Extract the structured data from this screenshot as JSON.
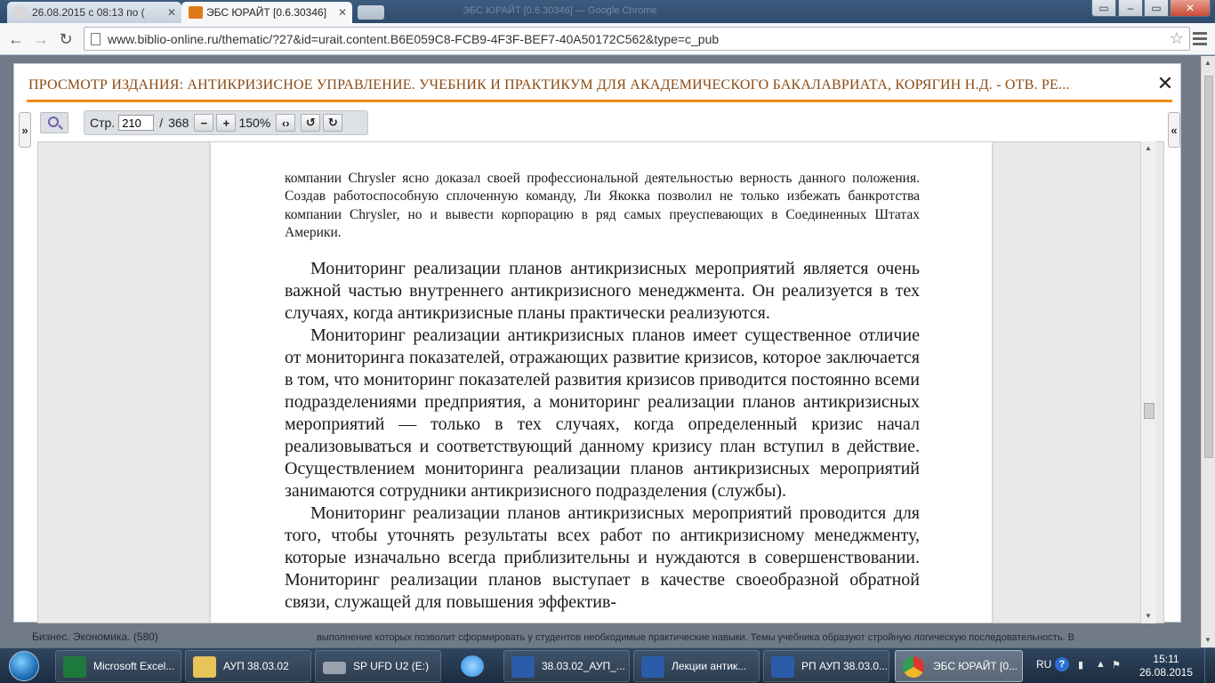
{
  "browser": {
    "tabs": [
      {
        "title": "26.08.2015 с 08:13 по (",
        "active": false,
        "favicon_color": "#d8d8d8"
      },
      {
        "title": "ЭБС ЮРАЙТ [0.6.30346]",
        "active": true,
        "favicon_color": "#e07a17"
      }
    ],
    "faint_title": "ЭБС ЮРАЙТ [0.6.30346] — Google Chrome",
    "address": "www.biblio-online.ru/thematic/?27&id=urait.content.B6E059C8-FCB9-4F3F-BEF7-40A50172C562&type=c_pub",
    "window_controls": {
      "minimize": "–",
      "maximize": "▭",
      "close": "✕"
    }
  },
  "viewer": {
    "title": "ПРОСМОТР ИЗДАНИЯ: АНТИКРИЗИСНОЕ УПРАВЛЕНИЕ. УЧЕБНИК И ПРАКТИКУМ ДЛЯ АКАДЕМИЧЕСКОГО БАКАЛАВРИАТА, КОРЯГИН Н.Д. - ОТВ. РЕ...",
    "close_label": "✕",
    "left_toggle": "»",
    "right_toggle": "«",
    "page_label": "Стр.",
    "page_current": "210",
    "page_separator": "/",
    "page_total": "368",
    "zoom_out": "−",
    "zoom_in": "+",
    "zoom_level": "150%",
    "fit_width": "‹›",
    "rotate_left": "↺",
    "rotate_right": "↻"
  },
  "document": {
    "quote_lines": [
      "компании Chrysler ясно доказал своей профессиональной деятельностью верность данного положения. Создав работоспособную сплоченную команду, Ли Якокка позволил не только избежать банкротства компании Chrysler, но и вывести корпорацию в ряд самых преуспевающих в Соединенных Штатах Америки."
    ],
    "paragraphs": [
      "Мониторинг реализации планов антикризисных мероприятий является очень важной частью внутреннего антикризисного менеджмента. Он реализуется в тех случаях, когда антикризисные планы практически реализуются.",
      "Мониторинг реализации антикризисных планов имеет существенное отличие от мониторинга показателей, отражающих развитие кризисов, которое заключается в том, что мониторинг показателей развития кризисов приводится постоянно всеми подразделениями предприятия, а мониторинг реализации планов антикризисных мероприятий — только в тех случаях, когда определенный кризис начал реализовываться и соответствующий данному кризису план вступил в действие. Осуществлением мониторинга реализации планов антикризисных мероприятий занимаются сотрудники антикризисного подразделения (службы).",
      "Мониторинг реализации планов антикризисных мероприятий проводится для того, чтобы уточнять результаты всех работ по антикризисному менеджменту, которые изначально всегда приблизительны и нуждаются в совершенствовании. Мониторинг реализации планов выступает в качестве своеобразной обратной связи, служащей для повышения эффектив-"
    ]
  },
  "background_page": {
    "left_text": "Бизнес. Экономика. (580)",
    "right_text": "выполнение которых позволит сформировать у студентов необходимые практические навыки. Темы учебника образуют стройную логическую последовательность. В"
  },
  "taskbar": {
    "items": [
      {
        "label": "Microsoft Excel...",
        "icon": "excel-icon",
        "color": "#1e7a3c"
      },
      {
        "label": "АУП 38.03.02",
        "icon": "folder-icon",
        "color": "#e7c35a"
      },
      {
        "label": "SP UFD U2 (E:)",
        "icon": "usb-drive-icon",
        "color": "#9aa3ad"
      },
      {
        "label": "",
        "icon": "internet-explorer-icon",
        "color": "#2c8be0"
      },
      {
        "label": "38.03.02_АУП_...",
        "icon": "word-icon",
        "color": "#2a5caa"
      },
      {
        "label": "Лекции антик...",
        "icon": "word-icon",
        "color": "#2a5caa"
      },
      {
        "label": "РП АУП 38.03.0...",
        "icon": "word-icon",
        "color": "#2a5caa"
      },
      {
        "label": "ЭБС ЮРАЙТ [0...",
        "icon": "chrome-icon",
        "color": "#d9a520"
      }
    ],
    "lang": "RU",
    "help": "?",
    "time": "15:11",
    "date": "26.08.2015"
  }
}
